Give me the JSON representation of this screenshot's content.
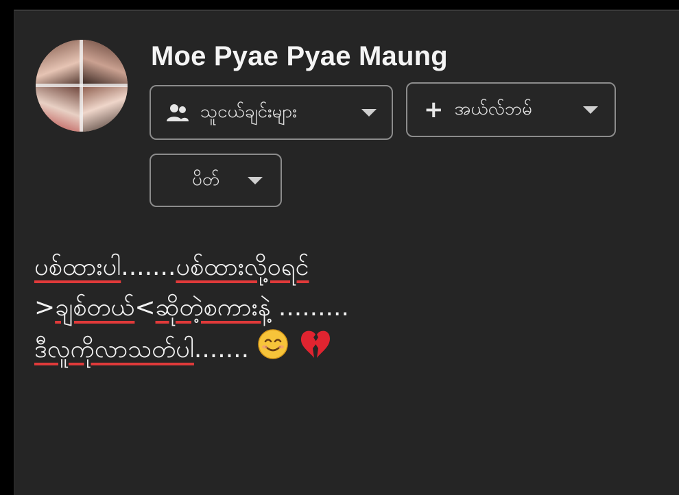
{
  "profile": {
    "name": "Moe Pyae Pyae Maung",
    "avatar_icon": "profile-photo"
  },
  "audience": {
    "friends_label": "သူငယ်ချင်းများ",
    "album_label": "အယ်လ်ဘမ်",
    "album_plus": "+",
    "privacy_label": "ပိတ်"
  },
  "post": {
    "line1_a": "ပစ်ထားပါ",
    "line1_b": ".......",
    "line1_c": "ပစ်ထားလို့ဝရင်",
    "line2_a": ">",
    "line2_b": "ချစ်တယ်",
    "line2_c": "<",
    "line2_d": "ဆိုတဲ့စကားနဲ့",
    "line2_e": " .........",
    "line3_a": "ဒီလူကိုလာသတ်ပါ",
    "line3_b": ".......",
    "emoji": [
      "smiling-face-icon",
      "broken-heart-icon"
    ]
  },
  "colors": {
    "background": "#252525",
    "text": "#f2f2f2",
    "spellcheck_underline": "#e03a3a",
    "button_border": "#8c8c8c"
  }
}
